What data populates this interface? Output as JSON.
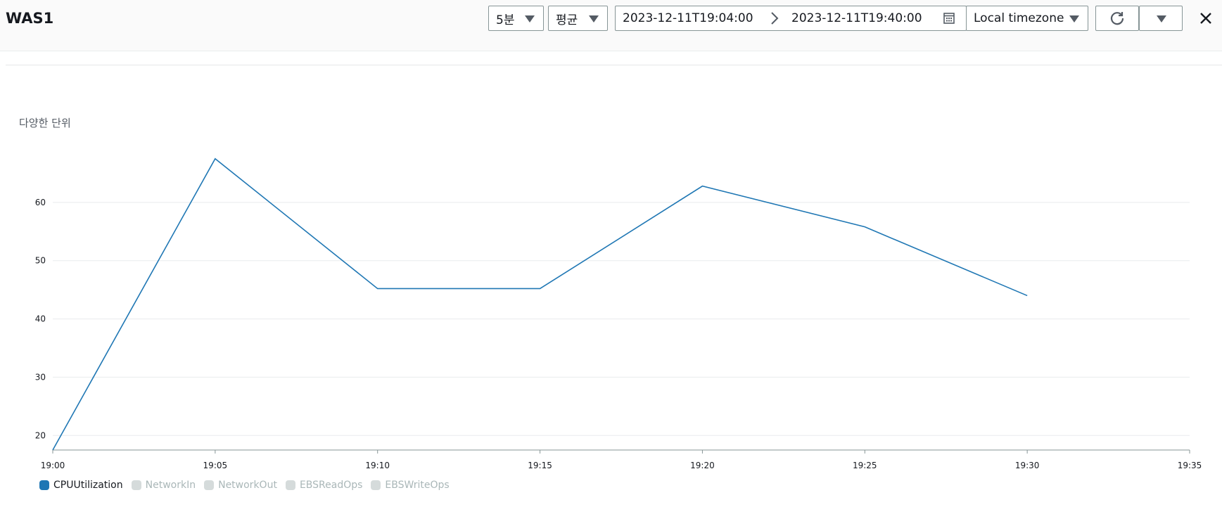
{
  "header": {
    "title": "WAS1",
    "period": "5분",
    "statistic": "평균",
    "range_start": "2023-12-11T19:04:00",
    "range_end": "2023-12-11T19:40:00",
    "timezone": "Local timezone"
  },
  "chart_data": {
    "type": "line",
    "ylabel": "다양한 단위",
    "x": [
      "19:00",
      "19:05",
      "19:10",
      "19:15",
      "19:20",
      "19:25",
      "19:30"
    ],
    "x_ticks": [
      "19:00",
      "19:05",
      "19:10",
      "19:15",
      "19:20",
      "19:25",
      "19:30",
      "19:35"
    ],
    "y_ticks": [
      20,
      30,
      40,
      50,
      60
    ],
    "ylim": [
      17.5,
      70
    ],
    "grid": true,
    "series": [
      {
        "name": "CPUUtilization",
        "values": [
          17.5,
          67.5,
          45.2,
          45.2,
          62.8,
          55.8,
          44.0
        ],
        "color": "#1f77b4",
        "visible": true
      }
    ],
    "legend": [
      {
        "name": "CPUUtilization",
        "visible": true
      },
      {
        "name": "NetworkIn",
        "visible": false
      },
      {
        "name": "NetworkOut",
        "visible": false
      },
      {
        "name": "EBSReadOps",
        "visible": false
      },
      {
        "name": "EBSWriteOps",
        "visible": false
      }
    ],
    "legend_position": "bottom-left"
  }
}
